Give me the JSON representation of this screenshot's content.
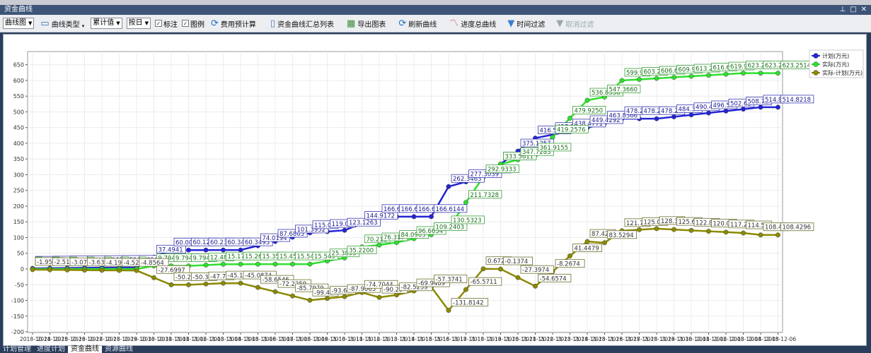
{
  "window": {
    "title": "资金曲线",
    "controls": [
      "pin-icon",
      "maximize-icon",
      "close-icon"
    ]
  },
  "toolbar": {
    "chart_view": "曲线图",
    "curve_type": "曲线类型",
    "value_mode": "累计值",
    "period": "按日",
    "label_check": "标注",
    "legend_check": "图例",
    "precompute": "费用预计算",
    "summary_list": "资金曲线汇总列表",
    "export": "导出图表",
    "refresh": "刷新曲线",
    "progress_curve": "进度总曲线",
    "time_filter": "时间过滤",
    "cancel_filter": "取消过滤"
  },
  "tabs": [
    {
      "label": "计划管理"
    },
    {
      "label": "进度计划"
    },
    {
      "label": "资金曲线",
      "active": true
    },
    {
      "label": "资源曲线"
    }
  ],
  "chart_data": {
    "type": "line",
    "ylim": [
      -200,
      650
    ],
    "yticks": [
      -200,
      -150,
      -100,
      -50,
      0,
      50,
      100,
      150,
      200,
      250,
      300,
      350,
      400,
      450,
      500,
      550,
      600,
      650
    ],
    "grid": true,
    "legend_placement": "top-right",
    "x": [
      "2018-10-24",
      "2018-10-25",
      "2018-10-26",
      "2018-10-27",
      "2018-10-28",
      "2018-10-29",
      "2018-10-30",
      "2018-10-31",
      "2018-11-01",
      "2018-11-02",
      "2018-11-03",
      "2018-11-04",
      "2018-11-05",
      "2018-11-06",
      "2018-11-07",
      "2018-11-08",
      "2018-11-09",
      "2018-11-10",
      "2018-11-11",
      "2018-11-12",
      "2018-11-13",
      "2018-11-14",
      "2018-11-15",
      "2018-11-16",
      "2018-11-17",
      "2018-11-18",
      "2018-11-19",
      "2018-11-20",
      "2018-11-21",
      "2018-11-22",
      "2018-11-23",
      "2018-11-24",
      "2018-11-25",
      "2018-11-26",
      "2018-11-27",
      "2018-11-28",
      "2018-11-29",
      "2018-11-30",
      "2018-12-01",
      "2018-12-02",
      "2018-12-03",
      "2018-12-04",
      "2018-12-05",
      "2018-12-06"
    ],
    "series": [
      {
        "name": "计划(万元)",
        "color": "#2323d6",
        "labels": [
          "1.9588",
          "2.518",
          "3.078",
          "3.637",
          "4.197",
          "4.526",
          "4.8564",
          "37.4941",
          "60.007",
          "60.121",
          "60.234",
          "60.348",
          "60.3493",
          "74.0194",
          "87.6805",
          "101.3952",
          "115.01",
          "119.06",
          "123.1263",
          "144.9172",
          "166.61",
          "166.61",
          "166.61",
          "166.6144",
          "262.3463",
          "277.3039",
          "292.26",
          "333.70",
          "375.1257",
          "416.5729",
          "427.52",
          "438.4771",
          "449.4292",
          "463.8366",
          "478.24",
          "478.24",
          "478.24",
          "484.34",
          "490.43",
          "496.53",
          "502.62",
          "508.72",
          "514.82",
          "514.8218"
        ]
      },
      {
        "name": "实际(万元)",
        "color": "#2ee02e",
        "labels": [
          "0",
          "0",
          "0",
          "0",
          "0",
          "0",
          "0",
          "9.7944",
          "9.7944",
          "9.7944",
          "12.482",
          "15.170",
          "15.265",
          "15.359",
          "15.454",
          "15.549",
          "15.549",
          "25.3895",
          "35.2200",
          "70.212",
          "76.317",
          "84.0905",
          "96.6654",
          "109.2403",
          "130.5323",
          "211.7328",
          "292.9333",
          "333.5611",
          "347.7283",
          "361.9155",
          "419.2576",
          "479.9250",
          "536.8958",
          "547.3660",
          "599.97",
          "603.29",
          "606.62",
          "609.95",
          "613.27",
          "616.60",
          "619.92",
          "623.25",
          "623.25",
          "623.2514"
        ]
      },
      {
        "name": "实际-计划(万元)",
        "color": "#8a8a00",
        "labels": [
          "-1.9588",
          "-2.518",
          "-3.078",
          "-3.637",
          "-4.197",
          "-4.526",
          "-4.8564",
          "-27.6997",
          "-50.21",
          "-50.32",
          "-47.75",
          "-45.17",
          "-45.0874",
          "-58.6546",
          "-72.2259",
          "-85.7979",
          "-99.46",
          "-93.68",
          "-87.9063",
          "-74.7044",
          "-90.29",
          "-82.5259",
          "-69.9489",
          "-57.3741",
          "-131.8142",
          "-65.5711",
          "0.6720",
          "-0.1374",
          "-27.3974",
          "-54.6574",
          "-8.2674",
          "41.4479",
          "87.423",
          "83.5294",
          "121.73",
          "125.05",
          "128.38",
          "125.60",
          "122.83",
          "120.06",
          "117.29",
          "114.52",
          "108.42",
          "108.4296"
        ]
      }
    ]
  }
}
